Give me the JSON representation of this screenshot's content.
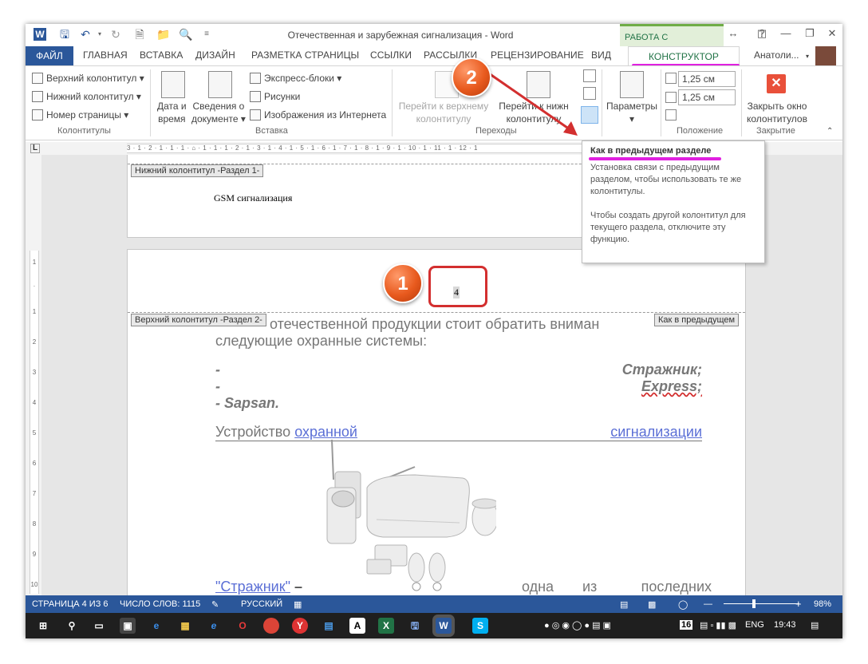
{
  "window": {
    "title": "Отечественная и зарубежная сигнализация - Word",
    "context_tab": "РАБОТА С КОЛОНТИТ...",
    "user": "Анатоли..."
  },
  "tabs": {
    "file": "ФАЙЛ",
    "items": [
      "ГЛАВНАЯ",
      "ВСТАВКА",
      "ДИЗАЙН",
      "РАЗМЕТКА СТРАНИЦЫ",
      "ССЫЛКИ",
      "РАССЫЛКИ",
      "РЕЦЕНЗИРОВАНИЕ",
      "ВИД"
    ],
    "design": "КОНСТРУКТОР"
  },
  "ribbon": {
    "header_btn": "Верхний колонтитул",
    "footer_btn": "Нижний колонтитул",
    "page_num_btn": "Номер страницы",
    "group_hf": "Колонтитулы",
    "date_time": [
      "Дата и",
      "время"
    ],
    "doc_info": [
      "Сведения о",
      "документе"
    ],
    "quick_parts": "Экспресс-блоки",
    "pictures": "Рисунки",
    "online_pictures": "Изображения из Интернета",
    "group_insert": "Вставка",
    "goto_header": [
      "Перейти к верхнему",
      "колонтитулу"
    ],
    "goto_footer": [
      "Перейти к нижн",
      "колонтитулу"
    ],
    "group_nav": "Переходы",
    "options": "Параметры",
    "header_pos": "1,25 см",
    "footer_pos": "1,25 см",
    "group_pos": "Положение",
    "close_hf": [
      "Закрыть окно",
      "колонтитулов"
    ],
    "group_close": "Закрытие"
  },
  "ruler": {
    "h_ticks": "3 · 1 · 2 · 1 · 1 · 1 · ⌂ · 1 · 1 · 1 · 2 · 1 · 3 · 1 · 4 · 1 · 5 · 1 · 6 · 1 · 7 · 1 · 8 · 1 · 9 · 1 · 10 · 1 · 11 · 1 · 12 · 1",
    "v_ticks": [
      "1",
      "·",
      "1",
      "2",
      "3",
      "4",
      "5",
      "6",
      "7",
      "8",
      "9",
      "10"
    ]
  },
  "document": {
    "footer_label": "Нижний колонтитул -Раздел 1-",
    "footer_text": "GSM сигнализация",
    "page_number": "4",
    "header_label": "Верхний колонтитул -Раздел 2-",
    "same_as_prev": "Как в предыдущем",
    "para1_start": "отечественной продукции стоит обратить вниман",
    "para1_end": "следующие охранные системы:",
    "list_dash": "-",
    "list1": "Стражник;",
    "list2": "Express;",
    "list3": "- Sapsan.",
    "device_prefix": "Устройство",
    "device_link1": "охранной",
    "device_link2": "сигнализации",
    "strazhnik_link": "\"Стражник\"",
    "strazhnik_dash": "–",
    "last_words": [
      "одна",
      "из",
      "последних"
    ]
  },
  "tooltip": {
    "title": "Как в предыдущем разделе",
    "p1": "Установка связи с предыдущим разделом, чтобы использовать те же колонтитулы.",
    "p2": "Чтобы создать другой колонтитул для текущего раздела, отключите эту функцию."
  },
  "badges": {
    "one": "1",
    "two": "2"
  },
  "status": {
    "page": "СТРАНИЦА 4 ИЗ 6",
    "words": "ЧИСЛО СЛОВ: 1115",
    "lang": "РУССКИЙ",
    "zoom": "98%",
    "zoom_level_pct": 40
  },
  "taskbar": {
    "lang": "ENG",
    "time": "19:43",
    "date_badge": "16"
  },
  "colors": {
    "word_blue": "#2b579a",
    "design_green": "#217346",
    "highlight_magenta": "#e020e0",
    "badge_orange": "#e85a1e",
    "callout_red": "#d32f2f"
  }
}
